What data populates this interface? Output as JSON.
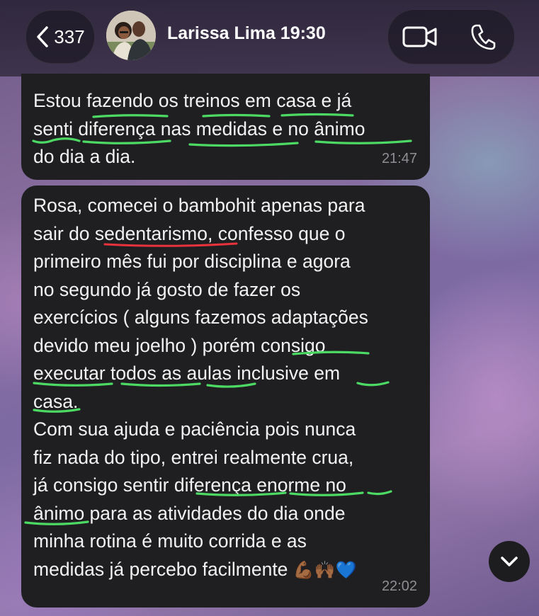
{
  "header": {
    "back_count": "337",
    "contact_name": "Larissa Lima 19:30",
    "icons": {
      "back": "chevron-left-icon",
      "video": "video-camera-icon",
      "voice": "phone-icon"
    }
  },
  "messages": [
    {
      "lines": [
        "Estou fazendo os treinos em casa e já",
        "senti diferença nas medidas e no ânimo",
        "do dia a dia."
      ],
      "time": "21:47"
    },
    {
      "lines": [
        "Rosa, comecei o bambohit apenas para",
        "sair do sedentarismo, confesso que o",
        "primeiro mês fui por disciplina e agora",
        "no segundo já gosto de fazer os",
        "exercícios ( alguns fazemos adaptações",
        "devido meu joelho ) porém consigo",
        "executar todos as aulas inclusive  em",
        "casa.",
        "Com sua ajuda e paciência pois nunca",
        "fiz nada do tipo, entrei realmente crua,",
        "já consigo sentir diferença enorme no",
        "ânimo para as atividades do dia onde",
        "minha rotina é muito corrida e as",
        "medidas já percebo facilmente"
      ],
      "emojis": [
        "💪🏾",
        "🙌🏾",
        "💙"
      ],
      "time": "22:02"
    }
  ],
  "colors": {
    "bubble": "#1f1f21",
    "text": "#f2f2f2",
    "timestamp": "#8e8e93",
    "green_marks": "#4cd964",
    "red_mark": "#e8323c"
  }
}
